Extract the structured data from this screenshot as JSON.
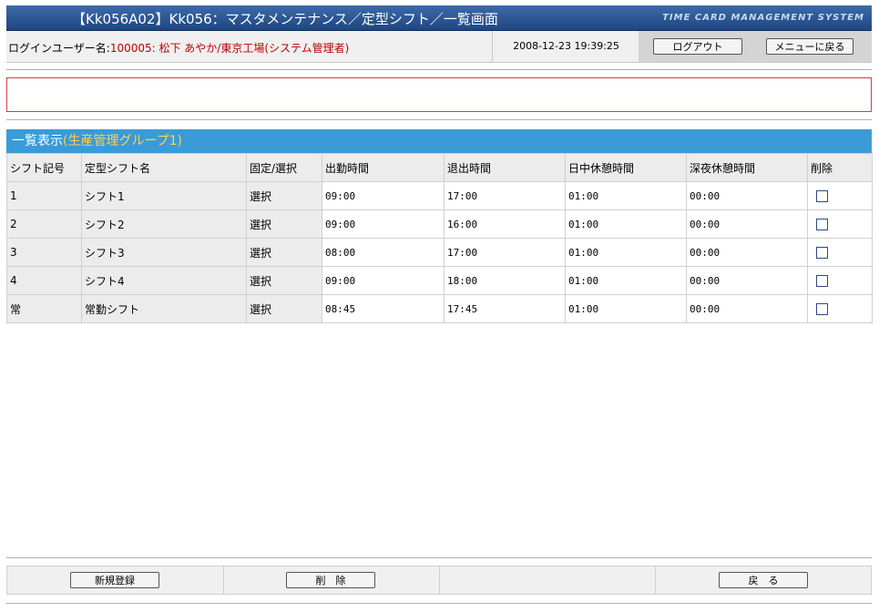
{
  "header": {
    "title": "【Kk056A02】Kk056：マスタメンテナンス／定型シフト／一覧画面",
    "logo": "TIME CARD MANAGEMENT SYSTEM"
  },
  "userbar": {
    "login_label": "ログインユーザー名:",
    "login_value": "100005: 松下 あやか/東京工場(システム管理者)",
    "datetime": "2008-12-23 19:39:25",
    "logout_label": "ログアウト",
    "menu_label": "メニューに戻る"
  },
  "section": {
    "title": "一覧表示",
    "group": "(生産管理グループ1)"
  },
  "table": {
    "headers": [
      "シフト記号",
      "定型シフト名",
      "固定/選択",
      "出勤時間",
      "退出時間",
      "日中休憩時間",
      "深夜休憩時間",
      "削除"
    ],
    "rows": [
      {
        "code": "1",
        "name": "シフト1",
        "type": "選択",
        "start": "09:00",
        "end": "17:00",
        "day_break": "01:00",
        "night_break": "00:00"
      },
      {
        "code": "2",
        "name": "シフト2",
        "type": "選択",
        "start": "09:00",
        "end": "16:00",
        "day_break": "01:00",
        "night_break": "00:00"
      },
      {
        "code": "3",
        "name": "シフト3",
        "type": "選択",
        "start": "08:00",
        "end": "17:00",
        "day_break": "01:00",
        "night_break": "00:00"
      },
      {
        "code": "4",
        "name": "シフト4",
        "type": "選択",
        "start": "09:00",
        "end": "18:00",
        "day_break": "01:00",
        "night_break": "00:00"
      },
      {
        "code": "常",
        "name": "常勤シフト",
        "type": "選択",
        "start": "08:45",
        "end": "17:45",
        "day_break": "01:00",
        "night_break": "00:00"
      }
    ]
  },
  "footer": {
    "new_label": "新規登録",
    "delete_label": "削　除",
    "back_label": "戻　る"
  }
}
